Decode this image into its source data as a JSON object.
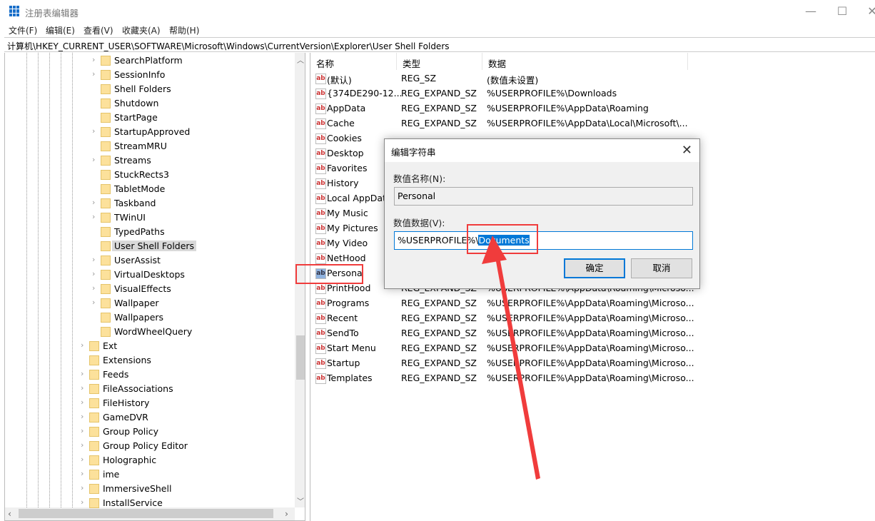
{
  "window": {
    "title": "注册表编辑器",
    "minimize": "—",
    "maximize": "☐",
    "close": "✕"
  },
  "menu": [
    "文件(F)",
    "编辑(E)",
    "查看(V)",
    "收藏夹(A)",
    "帮助(H)"
  ],
  "address": "计算机\\HKEY_CURRENT_USER\\SOFTWARE\\Microsoft\\Windows\\CurrentVersion\\Explorer\\User Shell Folders",
  "tree": {
    "explorer_children": [
      {
        "label": "SearchPlatform",
        "expandable": true
      },
      {
        "label": "SessionInfo",
        "expandable": true
      },
      {
        "label": "Shell Folders",
        "expandable": false
      },
      {
        "label": "Shutdown",
        "expandable": false
      },
      {
        "label": "StartPage",
        "expandable": false
      },
      {
        "label": "StartupApproved",
        "expandable": true
      },
      {
        "label": "StreamMRU",
        "expandable": false
      },
      {
        "label": "Streams",
        "expandable": true
      },
      {
        "label": "StuckRects3",
        "expandable": false
      },
      {
        "label": "TabletMode",
        "expandable": false
      },
      {
        "label": "Taskband",
        "expandable": true
      },
      {
        "label": "TWinUI",
        "expandable": true
      },
      {
        "label": "TypedPaths",
        "expandable": false
      },
      {
        "label": "User Shell Folders",
        "expandable": false,
        "selected": true
      },
      {
        "label": "UserAssist",
        "expandable": true
      },
      {
        "label": "VirtualDesktops",
        "expandable": true
      },
      {
        "label": "VisualEffects",
        "expandable": true
      },
      {
        "label": "Wallpaper",
        "expandable": true
      },
      {
        "label": "Wallpapers",
        "expandable": false
      },
      {
        "label": "WordWheelQuery",
        "expandable": false
      }
    ],
    "siblings": [
      {
        "label": "Ext",
        "expandable": true
      },
      {
        "label": "Extensions",
        "expandable": false
      },
      {
        "label": "Feeds",
        "expandable": true
      },
      {
        "label": "FileAssociations",
        "expandable": true
      },
      {
        "label": "FileHistory",
        "expandable": true
      },
      {
        "label": "GameDVR",
        "expandable": true
      },
      {
        "label": "Group Policy",
        "expandable": true
      },
      {
        "label": "Group Policy Editor",
        "expandable": true
      },
      {
        "label": "Holographic",
        "expandable": true
      },
      {
        "label": "ime",
        "expandable": true
      },
      {
        "label": "ImmersiveShell",
        "expandable": true
      },
      {
        "label": "InstallService",
        "expandable": true
      }
    ]
  },
  "list": {
    "headers": [
      "名称",
      "类型",
      "数据"
    ],
    "rows": [
      {
        "name": "(默认)",
        "type": "REG_SZ",
        "data": "(数值未设置)"
      },
      {
        "name": "{374DE290-12...",
        "type": "REG_EXPAND_SZ",
        "data": "%USERPROFILE%\\Downloads"
      },
      {
        "name": "AppData",
        "type": "REG_EXPAND_SZ",
        "data": "%USERPROFILE%\\AppData\\Roaming"
      },
      {
        "name": "Cache",
        "type": "REG_EXPAND_SZ",
        "data": "%USERPROFILE%\\AppData\\Local\\Microsoft\\..."
      },
      {
        "name": "Cookies",
        "type": "",
        "data": ""
      },
      {
        "name": "Desktop",
        "type": "",
        "data": ""
      },
      {
        "name": "Favorites",
        "type": "",
        "data": ""
      },
      {
        "name": "History",
        "type": "",
        "data": ""
      },
      {
        "name": "Local AppData",
        "type": "",
        "data": ""
      },
      {
        "name": "My Music",
        "type": "",
        "data": ""
      },
      {
        "name": "My Pictures",
        "type": "",
        "data": ""
      },
      {
        "name": "My Video",
        "type": "",
        "data": ""
      },
      {
        "name": "NetHood",
        "type": "",
        "data": ""
      },
      {
        "name": "Persona",
        "type": "",
        "data": "",
        "selected": true
      },
      {
        "name": "PrintHood",
        "type": "REG_EXPAND_SZ",
        "data": "%USERPROFILE%\\AppData\\Roaming\\Microso..."
      },
      {
        "name": "Programs",
        "type": "REG_EXPAND_SZ",
        "data": "%USERPROFILE%\\AppData\\Roaming\\Microso..."
      },
      {
        "name": "Recent",
        "type": "REG_EXPAND_SZ",
        "data": "%USERPROFILE%\\AppData\\Roaming\\Microso..."
      },
      {
        "name": "SendTo",
        "type": "REG_EXPAND_SZ",
        "data": "%USERPROFILE%\\AppData\\Roaming\\Microso..."
      },
      {
        "name": "Start Menu",
        "type": "REG_EXPAND_SZ",
        "data": "%USERPROFILE%\\AppData\\Roaming\\Microso..."
      },
      {
        "name": "Startup",
        "type": "REG_EXPAND_SZ",
        "data": "%USERPROFILE%\\AppData\\Roaming\\Microso..."
      },
      {
        "name": "Templates",
        "type": "REG_EXPAND_SZ",
        "data": "%USERPROFILE%\\AppData\\Roaming\\Microso..."
      }
    ]
  },
  "dialog": {
    "title": "编辑字符串",
    "close": "✕",
    "name_label": "数值名称(N):",
    "name_value": "Personal",
    "data_label": "数值数据(V):",
    "data_prefix": "%USERPROFILE%\\",
    "data_selected": "Documents",
    "ok": "确定",
    "cancel": "取消"
  },
  "annotation_color": "#f03c3c",
  "accent": "#0078d7"
}
